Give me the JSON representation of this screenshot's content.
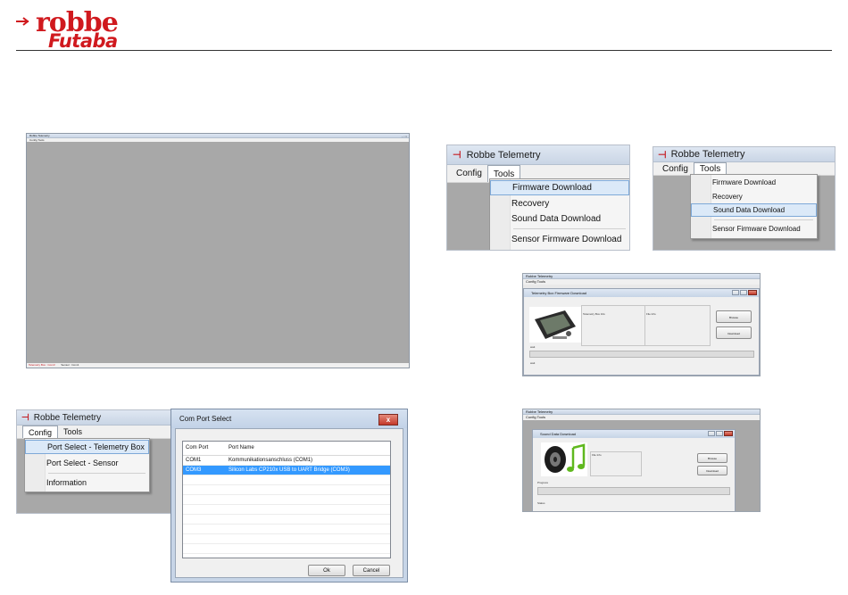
{
  "logo": {
    "line1": "robbe",
    "line2": "Futaba",
    "color": "#d0191e"
  },
  "app_title": "Robbe Telemetry",
  "main_window": {
    "title": "Robbe Telemetry",
    "menu": [
      "Config",
      "Tools"
    ],
    "status": {
      "left": "Telemetry Box : Com3",
      "right": "Sensor : Com1"
    }
  },
  "tools_menu_1": {
    "title": "Robbe Telemetry",
    "menu": [
      "Config",
      "Tools"
    ],
    "items": [
      "Firmware Download",
      "Recovery",
      "Sound Data Download",
      "Sensor Firmware Download"
    ],
    "highlighted": "Firmware Download"
  },
  "tools_menu_2": {
    "title": "Robbe Telemetry",
    "menu": [
      "Config",
      "Tools"
    ],
    "items": [
      "Firmware Download",
      "Recovery",
      "Sound Data Download",
      "Sensor Firmware Download"
    ],
    "highlighted": "Sound Data Download"
  },
  "config_menu": {
    "title": "Robbe Telemetry",
    "menu": [
      "Config",
      "Tools"
    ],
    "items": [
      "Port Select - Telemetry Box",
      "Port Select - Sensor",
      "Information"
    ],
    "highlighted": "Port Select - Telemetry Box"
  },
  "com_dialog": {
    "title": "Com Port Select",
    "close": "x",
    "headers": [
      "Com Port",
      "Port Name"
    ],
    "rows": [
      [
        "COM1",
        "Kommunikationsanschluss (COM1)"
      ],
      [
        "COM3",
        "Silicon Labs CP210x USB to UART Bridge (COM3)"
      ]
    ],
    "selected_row": 1,
    "ok": "Ok",
    "cancel": "Cancel"
  },
  "firmware_window": {
    "app_title": "Robbe Telemetry",
    "menu": [
      "Config",
      "Tools"
    ],
    "title": "Telemetry Box Firmware Download",
    "box_info": "Telemetry Box Info",
    "file_info": "File Info",
    "browse": "Browse",
    "download": "Download",
    "wait1": "wait",
    "wait2": "wait"
  },
  "sound_window": {
    "app_title": "Robbe Telemetry",
    "menu": [
      "Config",
      "Tools"
    ],
    "title": "Sound Data Download",
    "file_info": "File Info",
    "browse": "Browse",
    "download": "Download",
    "progress": "Progress",
    "status": "Status"
  }
}
